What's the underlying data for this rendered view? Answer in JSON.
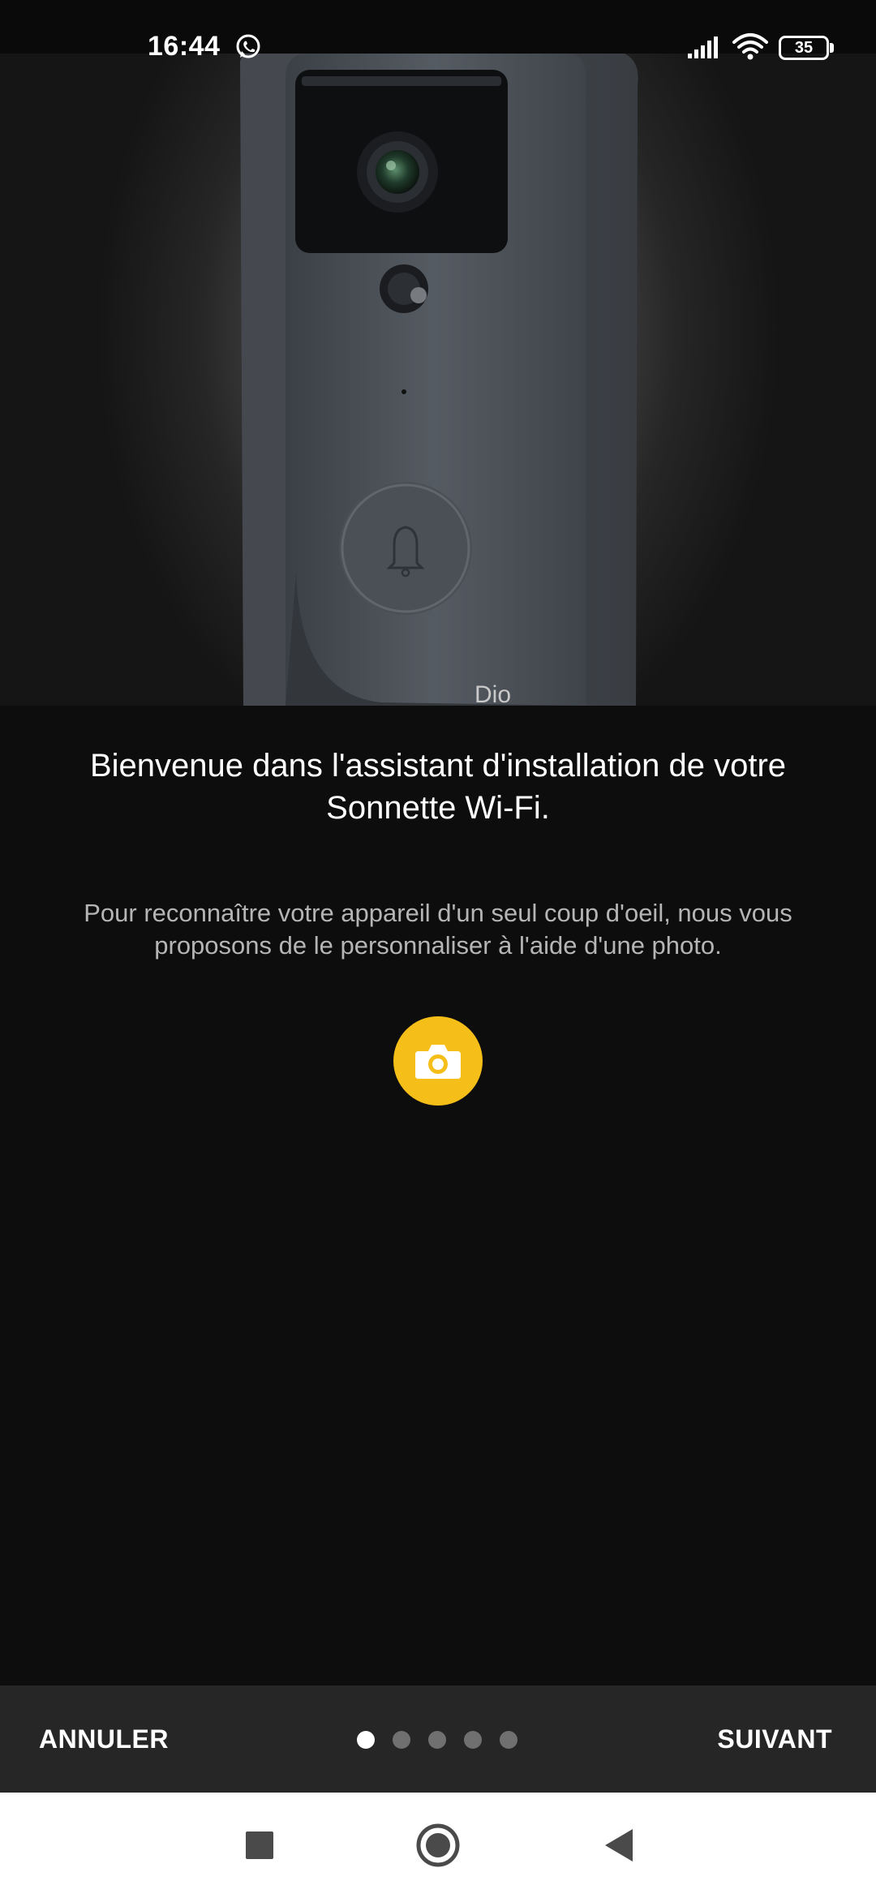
{
  "status_bar": {
    "time": "16:44",
    "battery_level": "35",
    "icons": [
      "whatsapp-icon",
      "signal-icon",
      "wifi-icon",
      "battery-icon"
    ]
  },
  "hero": {
    "image": "wifi-doorbell-photo",
    "brand_mark": "Dio"
  },
  "content": {
    "title": "Bienvenue dans l'assistant d'installation de votre Sonnette Wi-Fi.",
    "description": "Pour reconnaître votre appareil d'un seul coup d'oeil, nous vous proposons de le personnaliser à l'aide d'une photo.",
    "camera_button_icon": "camera-icon"
  },
  "footer": {
    "cancel_label": "ANNULER",
    "next_label": "SUIVANT",
    "page_count": 5,
    "current_page": 1
  },
  "navigation": {
    "buttons": [
      "recents-square-icon",
      "home-circle-icon",
      "back-triangle-icon"
    ]
  },
  "colors": {
    "accent": "#f6be19",
    "background": "#0d0d0d",
    "bottom_bar": "#262626",
    "nav_bar": "#ffffff"
  }
}
